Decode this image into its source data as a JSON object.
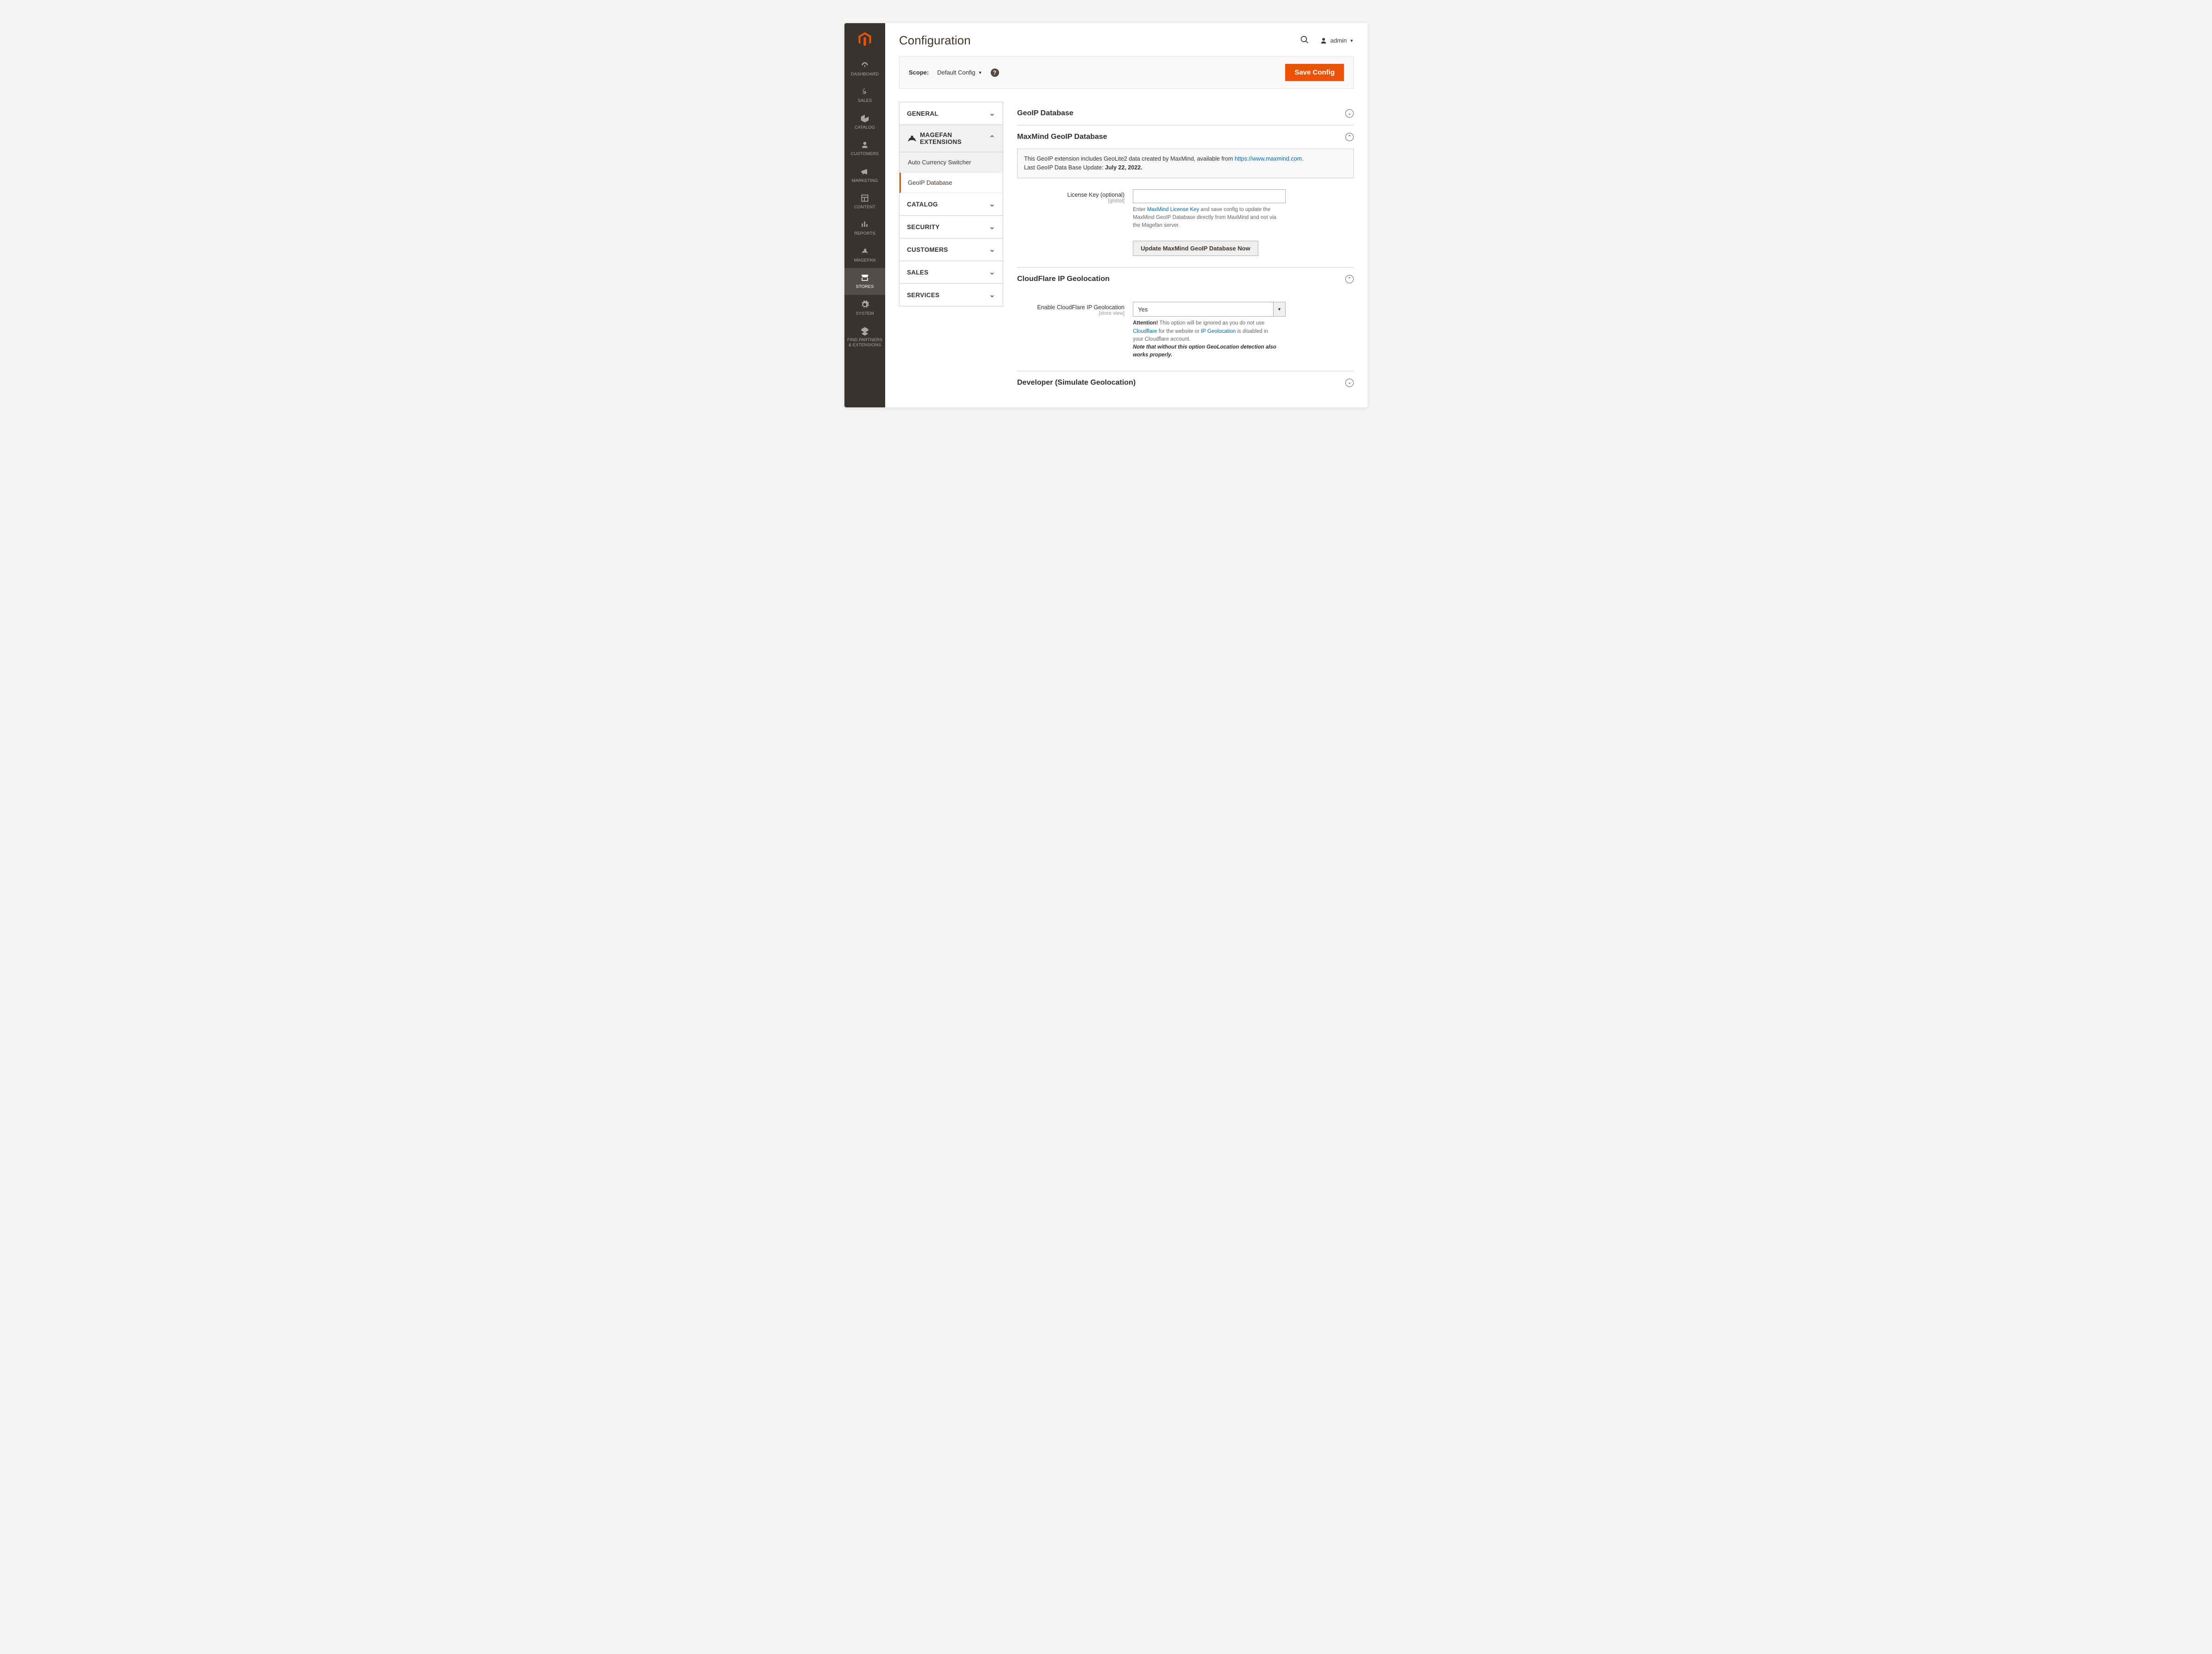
{
  "page": {
    "title": "Configuration"
  },
  "user": {
    "name": "admin"
  },
  "toolbar": {
    "scope_label": "Scope:",
    "scope_value": "Default Config",
    "save_label": "Save Config"
  },
  "sidebar": {
    "items": [
      {
        "key": "dashboard",
        "label": "DASHBOARD"
      },
      {
        "key": "sales",
        "label": "SALES"
      },
      {
        "key": "catalog",
        "label": "CATALOG"
      },
      {
        "key": "customers",
        "label": "CUSTOMERS"
      },
      {
        "key": "marketing",
        "label": "MARKETING"
      },
      {
        "key": "content",
        "label": "CONTENT"
      },
      {
        "key": "reports",
        "label": "REPORTS"
      },
      {
        "key": "magefan",
        "label": "MAGEFAN"
      },
      {
        "key": "stores",
        "label": "STORES"
      },
      {
        "key": "system",
        "label": "SYSTEM"
      },
      {
        "key": "partners",
        "label": "FIND PARTNERS & EXTENSIONS"
      }
    ]
  },
  "config_tabs": {
    "general": "GENERAL",
    "magefan_ext": "MAGEFAN EXTENSIONS",
    "sub_auto_currency": "Auto Currency Switcher",
    "sub_geoip": "GeoIP Database",
    "catalog": "CATALOG",
    "security": "SECURITY",
    "customers": "CUSTOMERS",
    "sales": "SALES",
    "services": "SERVICES"
  },
  "sections": {
    "geoip_db": {
      "title": "GeoIP Database"
    },
    "maxmind": {
      "title": "MaxMind GeoIP Database",
      "info_pre": "This GeoIP extension includes GeoLite2 data created by MaxMind, available from ",
      "info_link": "https://www.maxmind.com",
      "info_post": ".",
      "last_update_label": "Last GeoIP Data Base Update: ",
      "last_update_value": "July 22, 2022.",
      "license_label": "License Key (optional)",
      "license_scope": "[global]",
      "license_note_pre": "Enter ",
      "license_note_link": "MaxMind License Key",
      "license_note_post": " and save config to update the MaxMind GeoIP Database directly from MaxMind and not via the Magefan server.",
      "update_btn": "Update MaxMind GeoIP Database Now"
    },
    "cloudflare": {
      "title": "CloudFlare IP Geolocation",
      "enable_label": "Enable CloudFlare IP Geolocation",
      "enable_scope": "[store view]",
      "enable_value": "Yes",
      "note_attention": "Attention!",
      "note_p1": " This option will be ignored as you do not use ",
      "note_link1": "Cloudflare",
      "note_p2": " for the website or ",
      "note_link2": "IP Geolocation",
      "note_p3": " is disabled in your Cloudflare account.",
      "note_em": "Note that without this option GeoLocation detection also works properly."
    },
    "developer": {
      "title": "Developer (Simulate Geolocation)"
    }
  }
}
